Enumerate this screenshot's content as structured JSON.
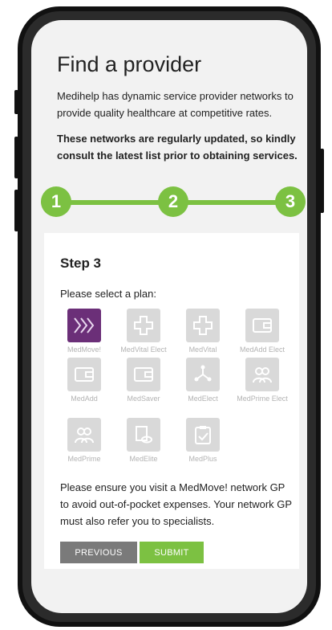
{
  "header": {
    "title": "Find a provider",
    "intro": "Medihelp has dynamic service provider networks to provide quality healthcare at competitive rates.",
    "notice": "These networks are regularly updated, so kindly consult the latest list prior to obtaining services."
  },
  "stepper": {
    "steps": [
      {
        "label": "1"
      },
      {
        "label": "2"
      },
      {
        "label": "3"
      }
    ],
    "color": "#7cc142"
  },
  "form": {
    "step_title": "Step 3",
    "select_label": "Please select a plan:",
    "plans": [
      {
        "name": "MedMove!",
        "icon": "chevrons-icon",
        "selected": true
      },
      {
        "name": "MedVital Elect",
        "icon": "medical-cross-icon",
        "selected": false
      },
      {
        "name": "MedVital",
        "icon": "medical-cross-icon",
        "selected": false
      },
      {
        "name": "MedAdd Elect",
        "icon": "wallet-icon",
        "selected": false
      },
      {
        "name": "MedAdd",
        "icon": "wallet-icon",
        "selected": false
      },
      {
        "name": "MedSaver",
        "icon": "wallet-icon",
        "selected": false
      },
      {
        "name": "MedElect",
        "icon": "network-icon",
        "selected": false
      },
      {
        "name": "MedPrime Elect",
        "icon": "people-icon",
        "selected": false
      },
      {
        "name": "MedPrime",
        "icon": "people-icon",
        "selected": false
      },
      {
        "name": "MedElite",
        "icon": "document-pills-icon",
        "selected": false
      },
      {
        "name": "MedPlus",
        "icon": "clipboard-check-icon",
        "selected": false
      }
    ],
    "note": "Please ensure you visit a MedMove! network GP to avoid out-of-pocket expenses. Your network GP must also refer you to specialists.",
    "previous_label": "PREVIOUS",
    "submit_label": "SUBMIT"
  },
  "colors": {
    "accent_green": "#7cc142",
    "selected_purple": "#6b2f78",
    "disabled_tile": "#d9d9d9"
  }
}
